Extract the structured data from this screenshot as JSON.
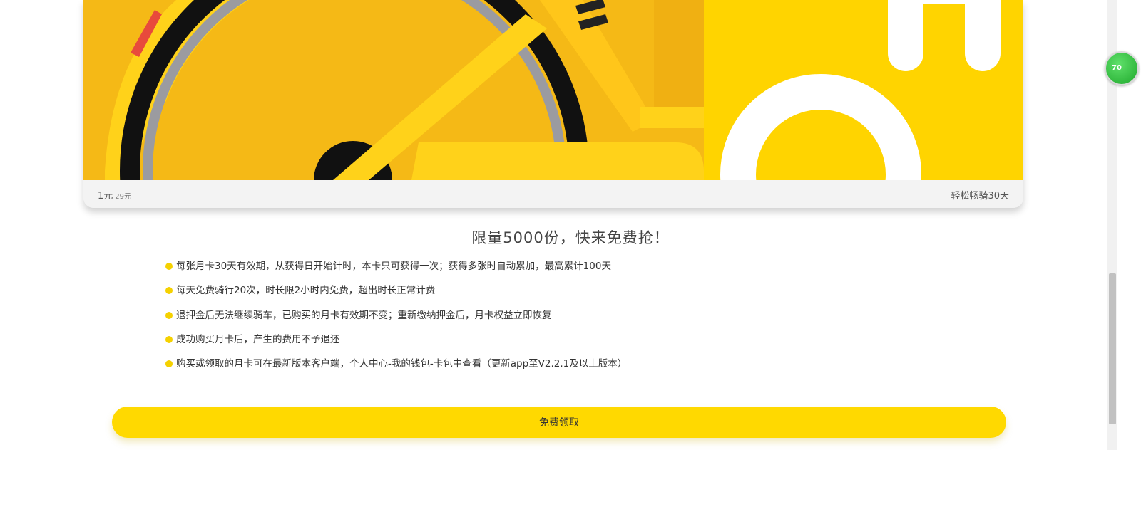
{
  "card": {
    "price": "1元",
    "original_price": "29元",
    "tagline": "轻松畅骑30天"
  },
  "headline": "限量5000份，快来免费抢！",
  "rules": [
    "每张月卡30天有效期，从获得日开始计时，本卡只可获得一次；获得多张时自动累加，最高累计100天",
    "每天免费骑行20次，时长限2小时内免费，超出时长正常计费",
    "退押金后无法继续骑车，已购买的月卡有效期不变；重新缴纳押金后，月卡权益立即恢复",
    "成功购买月卡后，产生的费用不予退还",
    "购买或领取的月卡可在最新版本客户端，个人中心-我的钱包-卡包中查看（更新app至V2.2.1及以上版本）"
  ],
  "cta": {
    "label": "免费领取"
  },
  "floating_badge": {
    "text": "70"
  },
  "colors": {
    "brand_yellow": "#ffd900",
    "art_yellow": "#f5b916",
    "bullet": "#f5d100"
  }
}
